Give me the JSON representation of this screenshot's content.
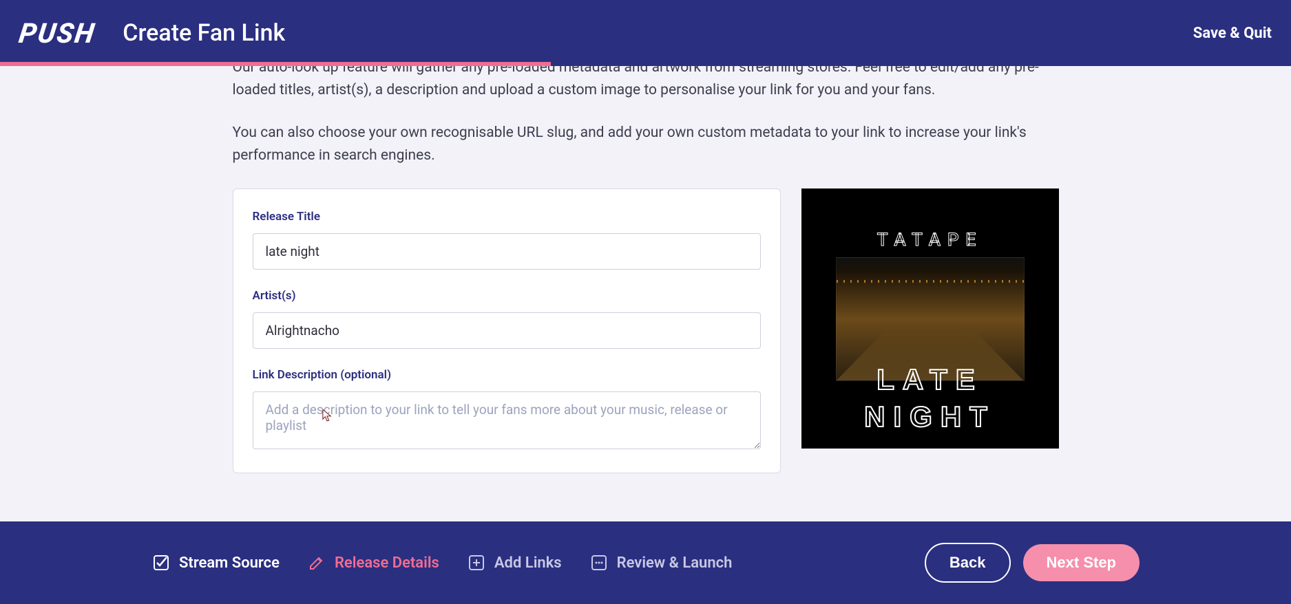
{
  "header": {
    "logo": "PUSH",
    "title": "Create Fan Link",
    "save_quit": "Save & Quit"
  },
  "intro": {
    "p1": "Our auto-look up feature will gather any pre-loaded metadata and artwork from streaming stores. Feel free to edit/add any pre-loaded titles, artist(s), a description and upload a custom image to personalise your link for you and your fans.",
    "p2": "You can also choose your own recognisable URL slug, and add your own custom metadata to your link to increase your link's performance in search engines."
  },
  "form": {
    "release_title": {
      "label": "Release Title",
      "value": "late night"
    },
    "artists": {
      "label": "Artist(s)",
      "value": "Alrightnacho"
    },
    "description": {
      "label": "Link Description (optional)",
      "placeholder": "Add a description to your link to tell your fans more about your music, release or playlist"
    }
  },
  "preview": {
    "artist_text": "TATAPE",
    "title_line1": "LATE",
    "title_line2": "NIGHT"
  },
  "steps": {
    "stream_source": "Stream Source",
    "release_details": "Release Details",
    "add_links": "Add Links",
    "review_launch": "Review & Launch"
  },
  "buttons": {
    "back": "Back",
    "next": "Next Step"
  }
}
